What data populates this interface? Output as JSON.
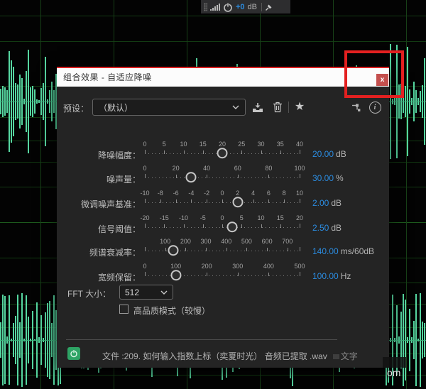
{
  "toolbar": {
    "gain_value": "+0",
    "gain_unit": "dB",
    "icons": [
      "grip",
      "level-meter",
      "power",
      "pin"
    ]
  },
  "watermark_bottom_right": "om",
  "dialog": {
    "title": "组合效果 - 自适应降噪",
    "close_label": "x",
    "preset": {
      "label": "预设：",
      "value": "（默认）",
      "icons": [
        "chevron-down",
        "save-preset",
        "delete-preset",
        "favorite-star",
        "effect-rack",
        "info"
      ]
    },
    "sliders": [
      {
        "label": "降噪幅度：",
        "ticks": [
          0,
          5,
          10,
          15,
          20,
          25,
          30,
          35,
          40
        ],
        "range": [
          0,
          40
        ],
        "value": 20,
        "value_text": "20.00",
        "unit": "dB"
      },
      {
        "label": "噪声量：",
        "ticks": [
          0,
          20,
          40,
          60,
          80,
          100
        ],
        "range": [
          0,
          100
        ],
        "value": 30,
        "value_text": "30.00",
        "unit": "%"
      },
      {
        "label": "微调噪声基准：",
        "ticks": [
          -10,
          -8,
          -6,
          -4,
          -2,
          0,
          2,
          4,
          6,
          8,
          10
        ],
        "range": [
          -10,
          10
        ],
        "value": 2,
        "value_text": "2.00",
        "unit": "dB"
      },
      {
        "label": "信号阈值：",
        "ticks": [
          -20,
          -15,
          -10,
          -5,
          0,
          5,
          10,
          15,
          20
        ],
        "range": [
          -20,
          20
        ],
        "value": 2.5,
        "value_text": "2.50",
        "unit": "dB"
      },
      {
        "label": "频谱衰减率：",
        "ticks": [
          100,
          200,
          300,
          400,
          500,
          600,
          700
        ],
        "range": [
          0,
          760
        ],
        "value": 140,
        "value_text": "140.00",
        "unit": "ms/60dB"
      },
      {
        "label": "宽频保留：",
        "ticks": [
          0,
          100,
          200,
          300,
          400,
          500
        ],
        "range": [
          0,
          500
        ],
        "value": 100,
        "value_text": "100.00",
        "unit": "Hz"
      }
    ],
    "fft": {
      "label": "FFT 大小：",
      "value": "512"
    },
    "quality_checkbox": {
      "label": "高品质模式（较慢）",
      "checked": false
    },
    "footer": {
      "file_text": "文件 :209. 如何输入指数上标（奕夏时光） 音频已提取 .wav",
      "watermark": "文字"
    }
  },
  "colors": {
    "accent_blue": "#2b8ce0",
    "waveform_green": "#56d6a0",
    "annotation_red": "#e32020",
    "close_button_red": "#c4504e",
    "power_green": "#2ea465"
  }
}
